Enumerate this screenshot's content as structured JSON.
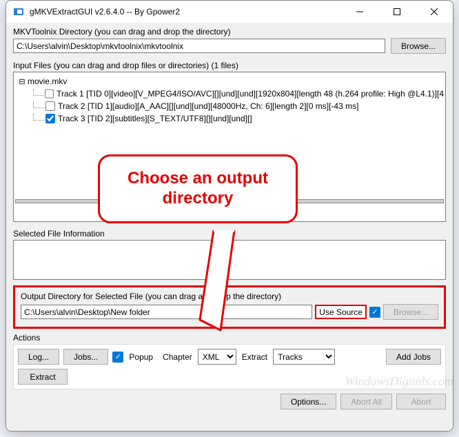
{
  "titlebar": {
    "title": "gMKVExtractGUI v2.6.4.0  --  By Gpower2"
  },
  "mkvtoolnix": {
    "label": "MKVToolnix Directory (you can drag and drop the directory)",
    "path": "C:\\Users\\alvin\\Desktop\\mkvtoolnix\\mkvtoolnix",
    "browse": "Browse..."
  },
  "inputfiles": {
    "label": "Input Files (you can drag and drop files or directories) (1 files)",
    "root": "movie.mkv",
    "tracks": [
      {
        "checked": false,
        "text": "Track 1 [TID 0][video][V_MPEG4/ISO/AVC][][und][und][1920x804][length 48 (h.264 profile: High @L4.1)][4"
      },
      {
        "checked": false,
        "text": "Track 2 [TID 1][audio][A_AAC][][und][und][48000Hz, Ch: 6][length 2][0 ms][-43 ms]"
      },
      {
        "checked": true,
        "text": "Track 3 [TID 2][subtitles][S_TEXT/UTF8][][und][und][]"
      }
    ]
  },
  "selectedfile": {
    "label": "Selected File Information"
  },
  "output": {
    "label": "Output Directory for Selected File (you can drag and drop the directory)",
    "path": "C:\\Users\\alvin\\Desktop\\New folder",
    "use_source": "Use Source",
    "browse": "Browse..."
  },
  "actions": {
    "label": "Actions",
    "log": "Log...",
    "jobs": "Jobs...",
    "popup": "Popup",
    "chapter_label": "Chapter",
    "chapter_value": "XML",
    "extract_label": "Extract",
    "extract_value": "Tracks",
    "add_jobs": "Add Jobs",
    "extract_btn": "Extract"
  },
  "bottom": {
    "options": "Options...",
    "abort_all": "Abort All",
    "abort": "Abort"
  },
  "callout": {
    "text": "Choose an output directory"
  },
  "watermark": "WindowsDigitals.com"
}
